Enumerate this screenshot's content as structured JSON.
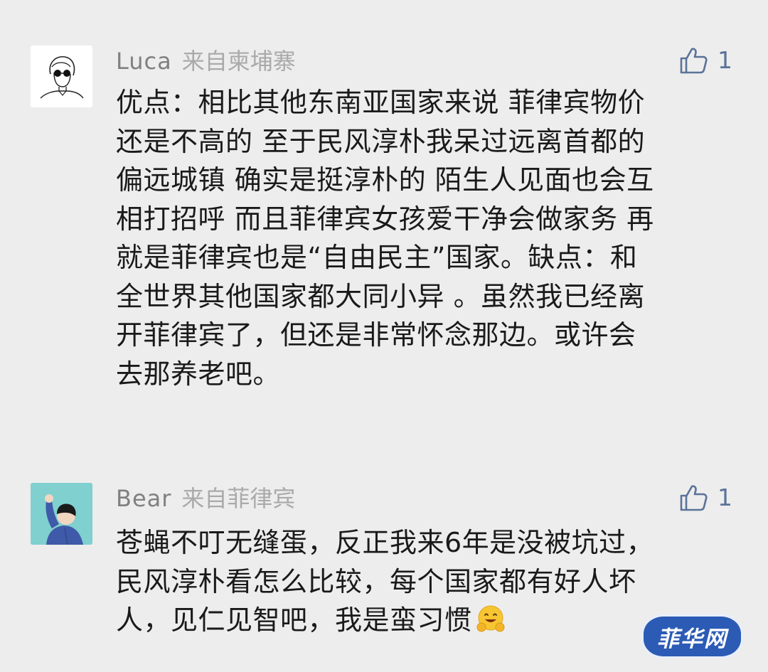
{
  "comments": [
    {
      "username": "Luca",
      "location": "来自柬埔寨",
      "likes": "1",
      "avatar_icon": "sketch-person-sunglasses-avatar",
      "lines": [
        "优点：相比其他东南亚国家来说 菲律宾物价",
        "还是不高的 至于民风淳朴我呆过远离首都的",
        "偏远城镇 确实是挺淳朴的 陌生人见面也会互",
        "相打招呼 而且菲律宾女孩爱干净会做家务 再",
        "就是菲律宾也是“自由民主”国家。缺点：和",
        "全世界其他国家都大同小异 。虽然我已经离",
        "开菲律宾了，但还是非常怀念那边。或许会",
        "去那养老吧。"
      ]
    },
    {
      "username": "Bear",
      "location": "来自菲律宾",
      "likes": "1",
      "avatar_icon": "waving-person-avatar",
      "lines": [
        "苍蝇不叮无缝蛋，反正我来6年是没被坑过，",
        "民风淳朴看怎么比较，每个国家都有好人坏",
        "人，见仁见智吧，我是蛮习惯"
      ],
      "trailing_emoji": "smiling-hands-emoji"
    }
  ],
  "watermark": {
    "text": "菲华网"
  },
  "colors": {
    "background": "#ededed",
    "username": "#808080",
    "location": "#aaaaaa",
    "body_text": "#1a1a1a",
    "like_icon": "#5b7398",
    "watermark_bg": "#2b5bb5"
  }
}
